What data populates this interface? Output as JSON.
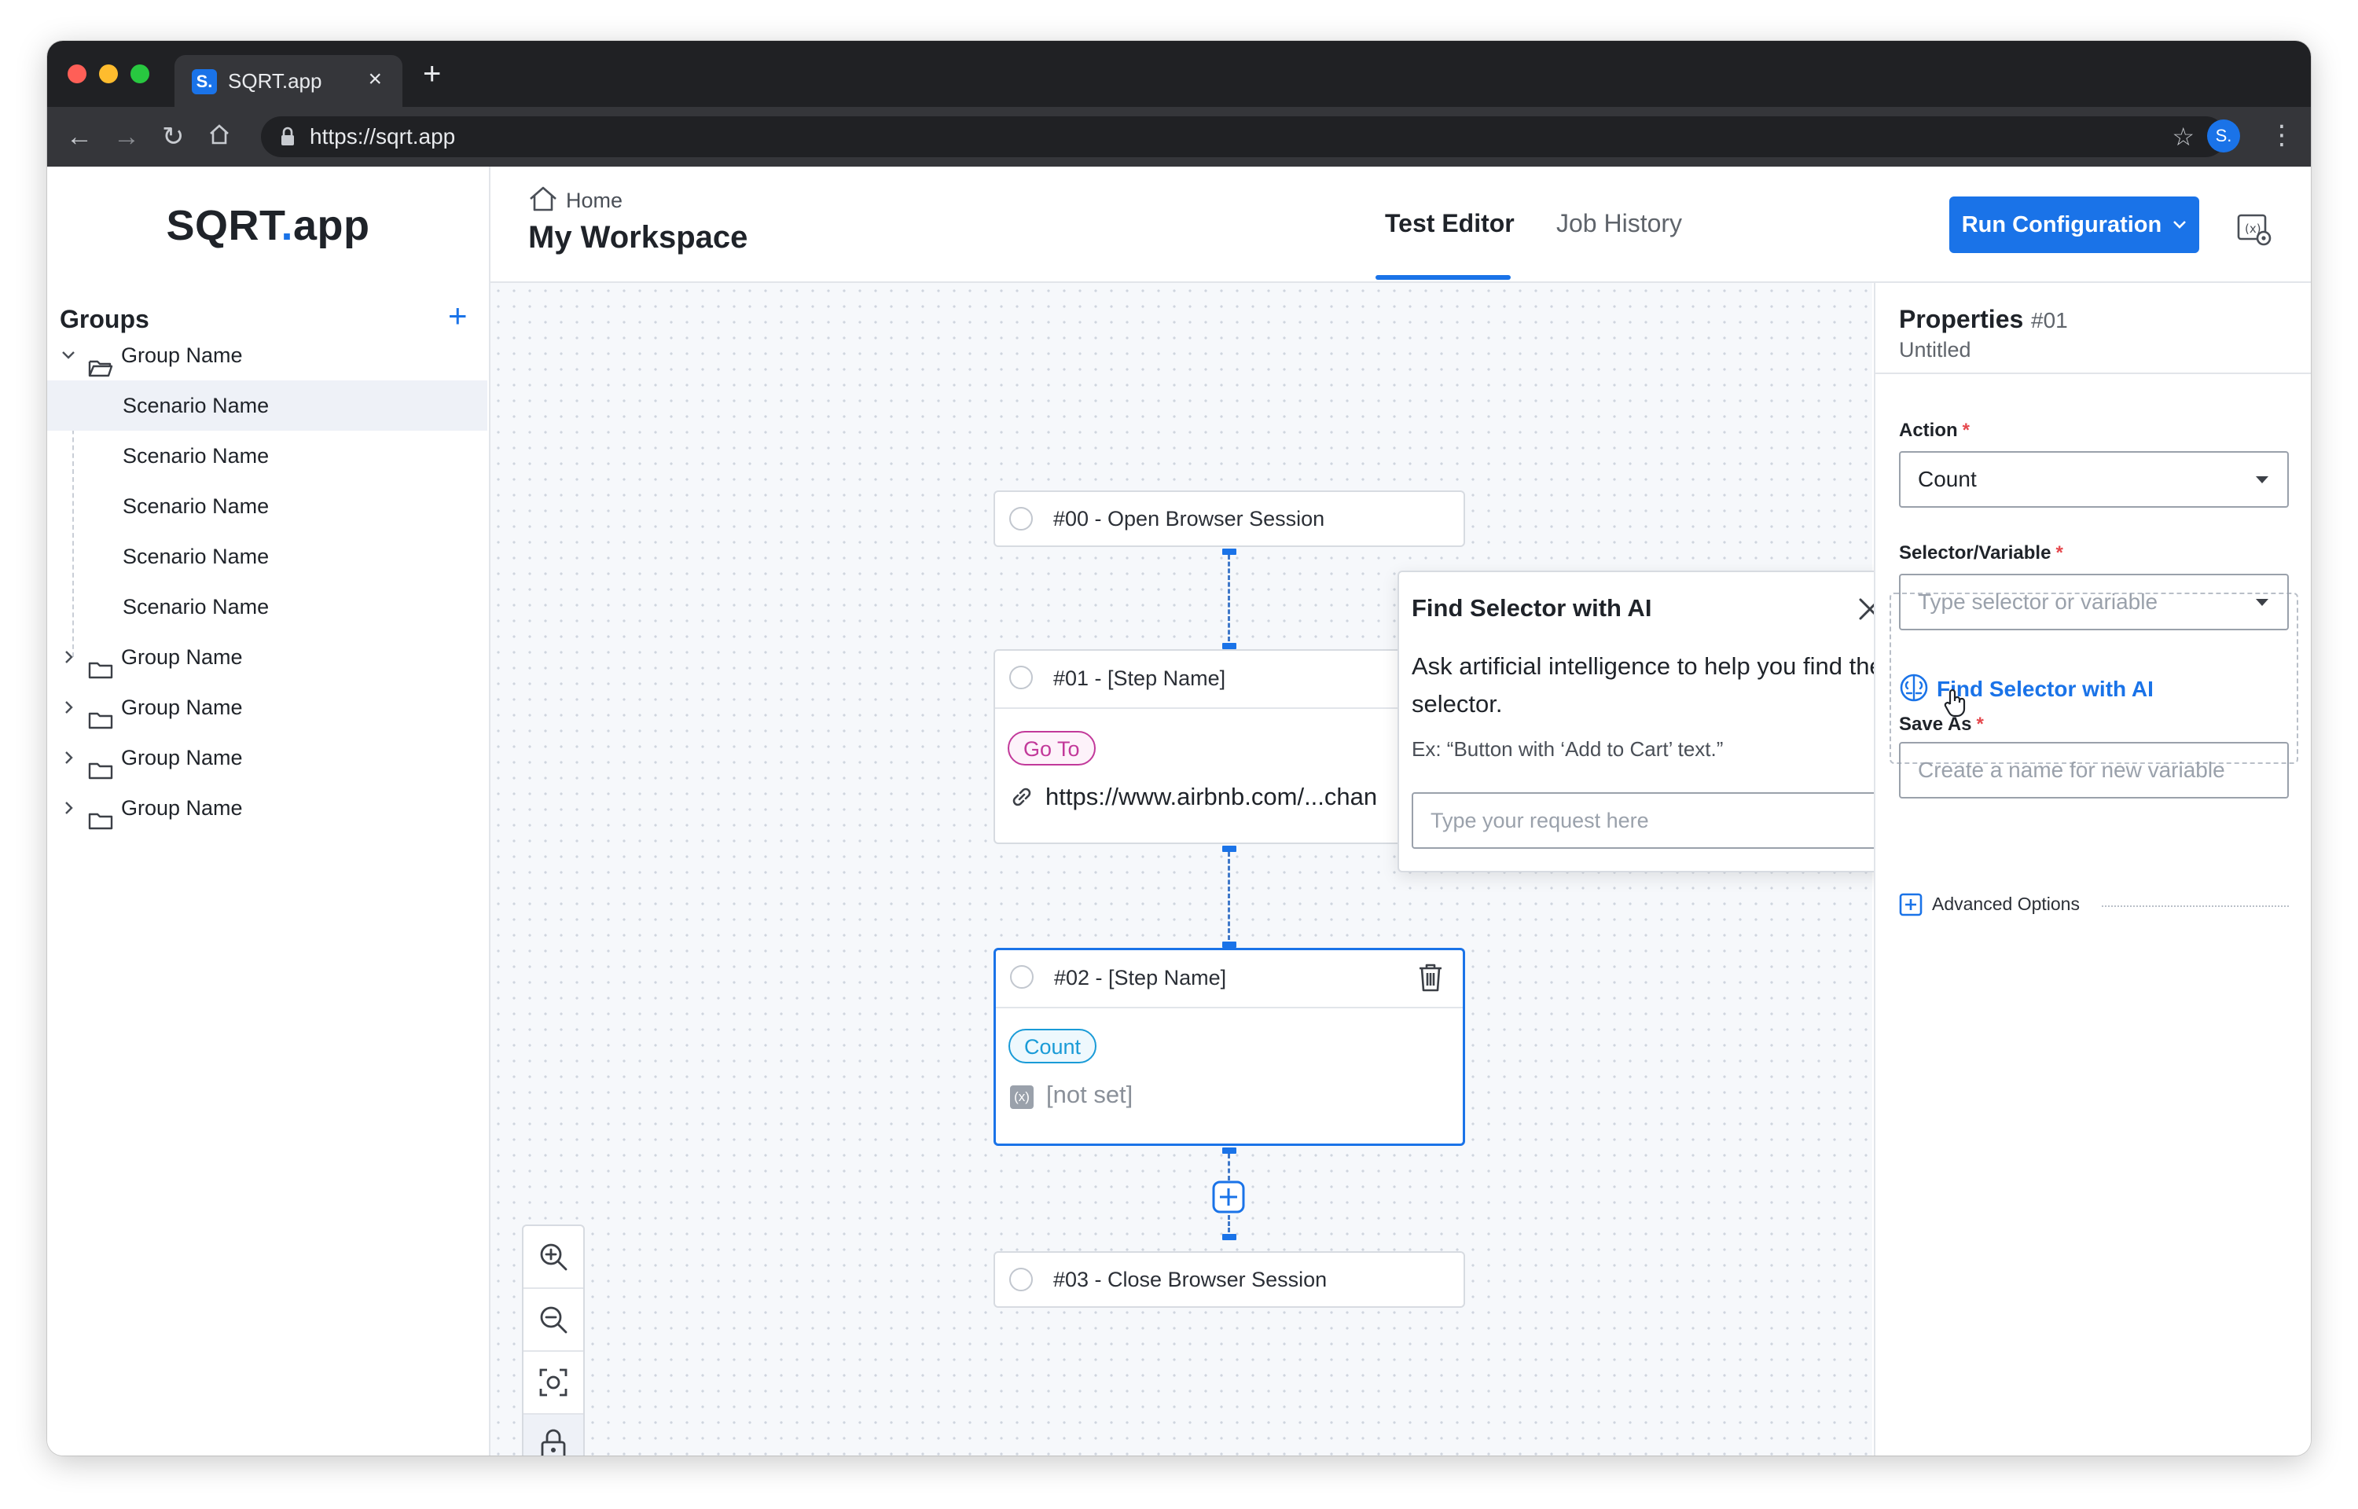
{
  "browser": {
    "tab_favicon": "S.",
    "tab_title": "SQRT.app",
    "tab_close": "×",
    "new_tab": "+",
    "url": "https://sqrt.app",
    "profile_initial": "S."
  },
  "header": {
    "logo_prefix": "SQRT",
    "logo_dot": ".",
    "logo_suffix": "app",
    "breadcrumb_home": "Home",
    "workspace_title": "My Workspace",
    "tabs": [
      {
        "label": "Test Editor",
        "active": true
      },
      {
        "label": "Job History",
        "active": false
      }
    ],
    "run_button": "Run Configuration"
  },
  "sidebar": {
    "title": "Groups",
    "add": "+",
    "groups": [
      {
        "label": "Group Name",
        "expanded": true,
        "children": [
          "Scenario Name",
          "Scenario Name",
          "Scenario Name",
          "Scenario Name",
          "Scenario Name"
        ],
        "selected_child": 0
      },
      {
        "label": "Group Name",
        "expanded": false
      },
      {
        "label": "Group Name",
        "expanded": false
      },
      {
        "label": "Group Name",
        "expanded": false
      },
      {
        "label": "Group Name",
        "expanded": false
      }
    ]
  },
  "canvas": {
    "nodes": [
      {
        "title": "#00 - Open Browser Session"
      },
      {
        "title": "#01 - [Step Name]",
        "action": "Go To",
        "url": "https://www.airbnb.com/...chan"
      },
      {
        "title": "#02 - [Step Name]",
        "action": "Count",
        "value": "[not set]",
        "value_icon": "(x)",
        "selected": true
      },
      {
        "title": "#03 - Close Browser Session"
      }
    ]
  },
  "popover": {
    "title": "Find Selector with AI",
    "description": "Ask artificial intelligence to help you find the selector.",
    "example": "Ex: “Button with ‘Add to Cart’ text.”",
    "input_placeholder": "Type your request here"
  },
  "properties": {
    "title": "Properties",
    "number": "#01",
    "subtitle": "Untitled",
    "action_label": "Action",
    "action_value": "Count",
    "required_mark": "*",
    "selector_label": "Selector/Variable",
    "selector_placeholder": "Type selector or variable",
    "ai_link": "Find Selector with AI",
    "save_as_label": "Save As",
    "save_as_placeholder": "Create a name for new variable",
    "advanced": "Advanced Options"
  },
  "colors": {
    "accent": "#1a73e8",
    "goto_pill": "#c2399a",
    "count_pill": "#1a9bd7",
    "required": "#e5484d"
  }
}
